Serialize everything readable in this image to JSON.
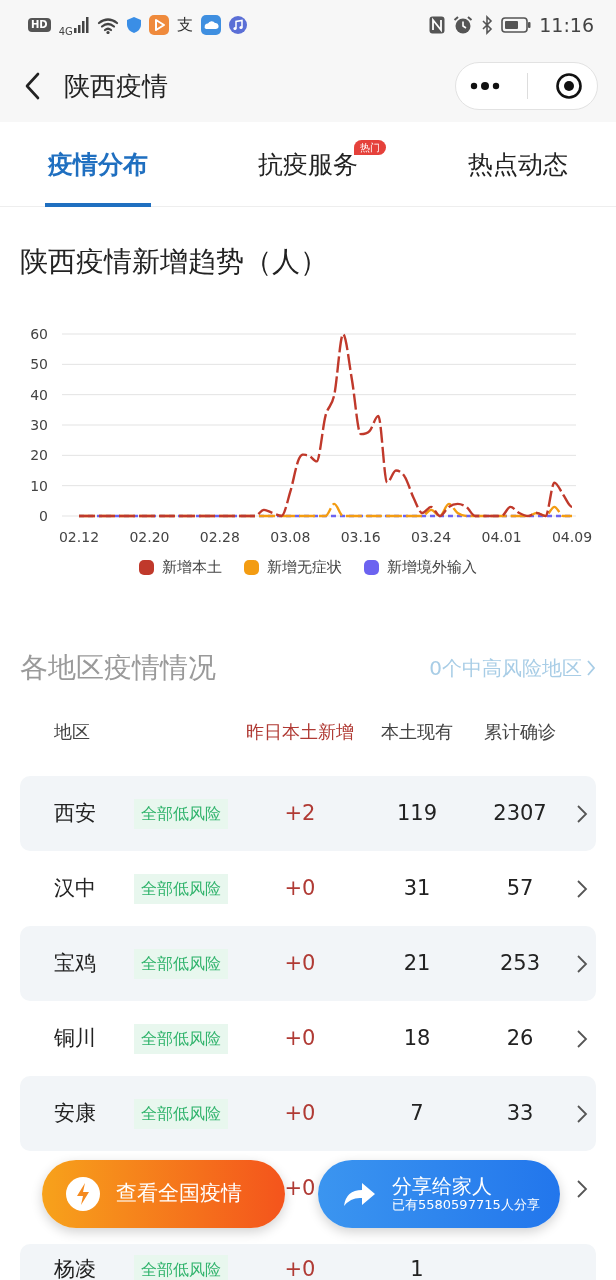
{
  "status_bar": {
    "badges": [
      "HD",
      "4G"
    ],
    "app_glyph": "支",
    "time": "11:16"
  },
  "header": {
    "title": "陕西疫情"
  },
  "tabs": [
    {
      "label": "疫情分布",
      "selected": true
    },
    {
      "label": "抗疫服务",
      "selected": false,
      "badge": "热门"
    },
    {
      "label": "热点动态",
      "selected": false
    }
  ],
  "trend": {
    "title": "陕西疫情新增趋势（人）",
    "chart_data": {
      "type": "line",
      "categories": [
        "02.12",
        null,
        null,
        null,
        null,
        null,
        null,
        null,
        "02.20",
        null,
        null,
        null,
        null,
        null,
        null,
        null,
        "02.28",
        null,
        null,
        null,
        null,
        null,
        null,
        null,
        "03.08",
        null,
        null,
        null,
        null,
        null,
        null,
        null,
        "03.16",
        null,
        null,
        null,
        null,
        null,
        null,
        null,
        "03.24",
        null,
        null,
        null,
        null,
        null,
        null,
        null,
        "04.01",
        null,
        null,
        null,
        null,
        null,
        null,
        null,
        "04.09"
      ],
      "grid": true,
      "legend": "bottom",
      "series": [
        {
          "name": "新增本土",
          "color": "#c0392b",
          "line_style": "dashed",
          "values": [
            0,
            0,
            0,
            0,
            0,
            0,
            0,
            0,
            0,
            0,
            0,
            0,
            0,
            0,
            0,
            0,
            0,
            0,
            0,
            0,
            0,
            2,
            1,
            0,
            8,
            19,
            20,
            18,
            33,
            40,
            60,
            45,
            27,
            28,
            33,
            11,
            15,
            13,
            6,
            1,
            3,
            0,
            3,
            4,
            3,
            0,
            0,
            0,
            0,
            3,
            1,
            0,
            1,
            0,
            11,
            7,
            3
          ]
        },
        {
          "name": "新增无症状",
          "color": "#f39c12",
          "line_style": "dashed",
          "values": [
            0,
            0,
            0,
            0,
            0,
            0,
            0,
            0,
            0,
            0,
            0,
            0,
            0,
            0,
            0,
            0,
            0,
            0,
            0,
            0,
            0,
            0,
            0,
            0,
            0,
            0,
            0,
            0,
            0,
            4,
            0,
            0,
            0,
            0,
            0,
            0,
            0,
            0,
            0,
            0,
            2,
            0,
            4,
            1,
            0,
            0,
            0,
            0,
            0,
            0,
            0,
            0,
            1,
            0,
            3,
            0,
            0
          ]
        },
        {
          "name": "新增境外输入",
          "color": "#6c63f0",
          "line_style": "dotted",
          "values": [
            0,
            0,
            0,
            0,
            0,
            0,
            0,
            0,
            0,
            0,
            0,
            0,
            0,
            0,
            0,
            0,
            0,
            0,
            0,
            0,
            0,
            0,
            0,
            0,
            0,
            0,
            0,
            0,
            0,
            0,
            0,
            0,
            0,
            0,
            0,
            0,
            0,
            0,
            0,
            0,
            0,
            0,
            0,
            0,
            0,
            0,
            0,
            0,
            0,
            0,
            0,
            0,
            0,
            0,
            0,
            0,
            0
          ]
        }
      ],
      "ylim": [
        0,
        60
      ],
      "yticks": [
        0,
        10,
        20,
        30,
        40,
        50,
        60
      ]
    }
  },
  "regions": {
    "title": "各地区疫情情况",
    "link": "0个中高风险地区",
    "columns": [
      {
        "label": "地区",
        "highlighted": false
      },
      {
        "label": "昨日本土新增",
        "highlighted": true
      },
      {
        "label": "本土现有",
        "highlighted": false
      },
      {
        "label": "累计确诊",
        "highlighted": false
      }
    ],
    "rows": [
      {
        "region": "西安",
        "risk": "全部低风险",
        "change": "+2",
        "current": "119",
        "total": "2307",
        "chevron": true
      },
      {
        "region": "汉中",
        "risk": "全部低风险",
        "change": "+0",
        "current": "31",
        "total": "57",
        "chevron": true
      },
      {
        "region": "宝鸡",
        "risk": "全部低风险",
        "change": "+0",
        "current": "21",
        "total": "253",
        "chevron": true
      },
      {
        "region": "铜川",
        "risk": "全部低风险",
        "change": "+0",
        "current": "18",
        "total": "26",
        "chevron": true
      },
      {
        "region": "安康",
        "risk": "全部低风险",
        "change": "+0",
        "current": "7",
        "total": "33",
        "chevron": true
      },
      {
        "change": "+0",
        "chevron": true
      },
      {
        "region": "杨凌",
        "risk": "全部低风险",
        "change": "+0",
        "current": "1",
        "chevron": false
      }
    ]
  },
  "actions": [
    {
      "kind": "national",
      "label": "查看全国疫情"
    },
    {
      "kind": "share",
      "label": "分享给家人",
      "subtitle": "已有5580597715人分享"
    }
  ]
}
